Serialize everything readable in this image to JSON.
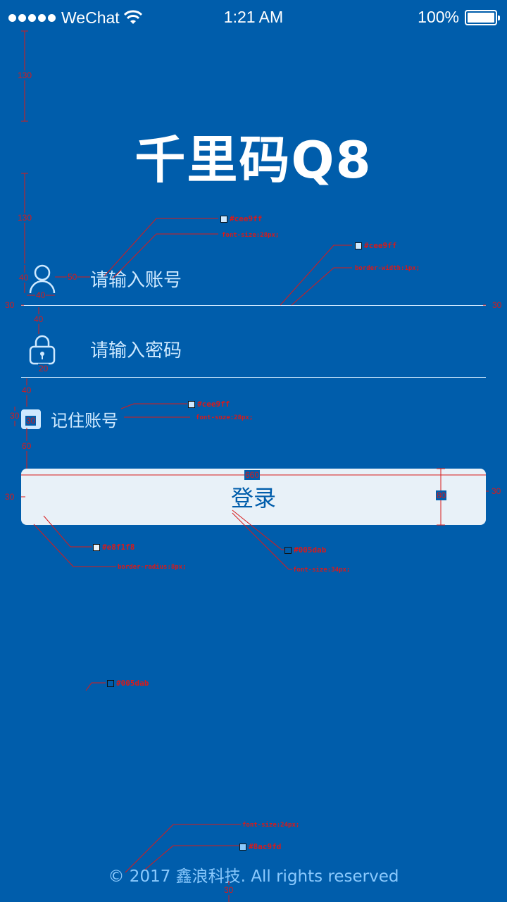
{
  "status": {
    "carrier": "WeChat",
    "time": "1:21 AM",
    "battery": "100%"
  },
  "app": {
    "title": "千里码Q8"
  },
  "login": {
    "account_placeholder": "请输入账号",
    "password_placeholder": "请输入密码",
    "remember_label": "记住账号",
    "submit_label": "登录"
  },
  "footer": {
    "copyright": "© 2017 鑫浪科技. All rights reserved"
  },
  "annotations": {
    "gap_top": "130",
    "gap_logo": "130",
    "icon_h": "40",
    "icon_gap": "50",
    "icon_w": "40",
    "margin_left_1": "30",
    "margin_right_1": "30",
    "field_gap": "40",
    "lock_w": "20",
    "remember_gap": "40",
    "check_h": "30",
    "check_w": "30",
    "button_gap": "60",
    "button_w": "660",
    "button_h": "80",
    "margin_left_2": "30",
    "margin_right_2": "30",
    "footer_bottom": "30",
    "color_placeholder": "#cee9ff",
    "font_placeholder": "font-size:28px;",
    "color_border": "#cee9ff",
    "border_width": "border-width:1px;",
    "color_remember": "#cee9ff",
    "font_remember": "font-soze:28px;",
    "color_button": "#e8f1f8",
    "radius_button": "border-radius:8px;",
    "color_button_text": "#005dab",
    "font_button": "font-size:34px;",
    "color_bg": "#005dab",
    "font_footer": "font-size:24px;",
    "color_footer": "#8ac9fd"
  },
  "colors": {
    "background": "#005dab",
    "placeholder": "#cee9ff",
    "button": "#e8f1f8",
    "footer": "#8ac9fd",
    "annotation": "#d81a1a"
  }
}
